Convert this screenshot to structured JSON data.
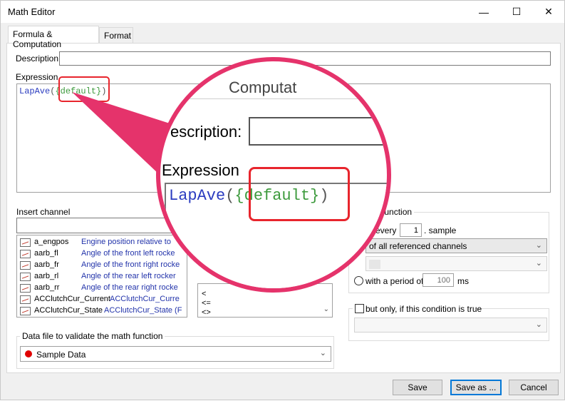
{
  "window": {
    "title": "Math Editor",
    "minimize_glyph": "—",
    "maximize_glyph": "☐",
    "close_glyph": "✕"
  },
  "tabs": [
    {
      "label": "Formula & Computation",
      "active": true
    },
    {
      "label": "Format",
      "active": false
    }
  ],
  "description": {
    "label": "Description:",
    "value": ""
  },
  "expression": {
    "label": "Expression",
    "function": "LapAve",
    "open": "(",
    "channel": "{default}",
    "close": ")"
  },
  "insert_channel": {
    "label": "Insert channel",
    "search_value": "",
    "channels": [
      {
        "name": "a_engpos",
        "description": "Engine position relative to"
      },
      {
        "name": "aarb_fl",
        "description": "Angle of the front left rocke"
      },
      {
        "name": "aarb_fr",
        "description": "Angle of the front right rocke"
      },
      {
        "name": "aarb_rl",
        "description": "Angle of the rear left rocker"
      },
      {
        "name": "aarb_rr",
        "description": "Angle of the rear right rocke"
      },
      {
        "name": "ACClutchCur_Current",
        "description": "ACClutchCur_Curre"
      },
      {
        "name": "ACClutchCur_State",
        "description": "ACClutchCur_State (F"
      }
    ]
  },
  "operators": [
    "<",
    "<=",
    "<>"
  ],
  "compute_function": {
    "title": "ute function",
    "every_prefix": "or every",
    "every_value": "1",
    "every_suffix": ". sample",
    "scope_selected": "of all referenced channels",
    "period_label": "with a period of",
    "period_value": "100",
    "period_unit": "ms"
  },
  "condition": {
    "label": "but only, if this condition is true",
    "value": ""
  },
  "data_file": {
    "title": "Data file to validate the math function",
    "selected": "Sample Data",
    "dot_color": "#e00000"
  },
  "buttons": {
    "save": "Save",
    "save_as": "Save as ...",
    "cancel": "Cancel"
  },
  "callout": {
    "heading_fragment": "Computat",
    "description_fragment": "escription:",
    "expression_label": "Expression",
    "function": "LapAve",
    "open": "(",
    "channel": "{default}",
    "close": ")",
    "accent_color": "#e5336b"
  }
}
